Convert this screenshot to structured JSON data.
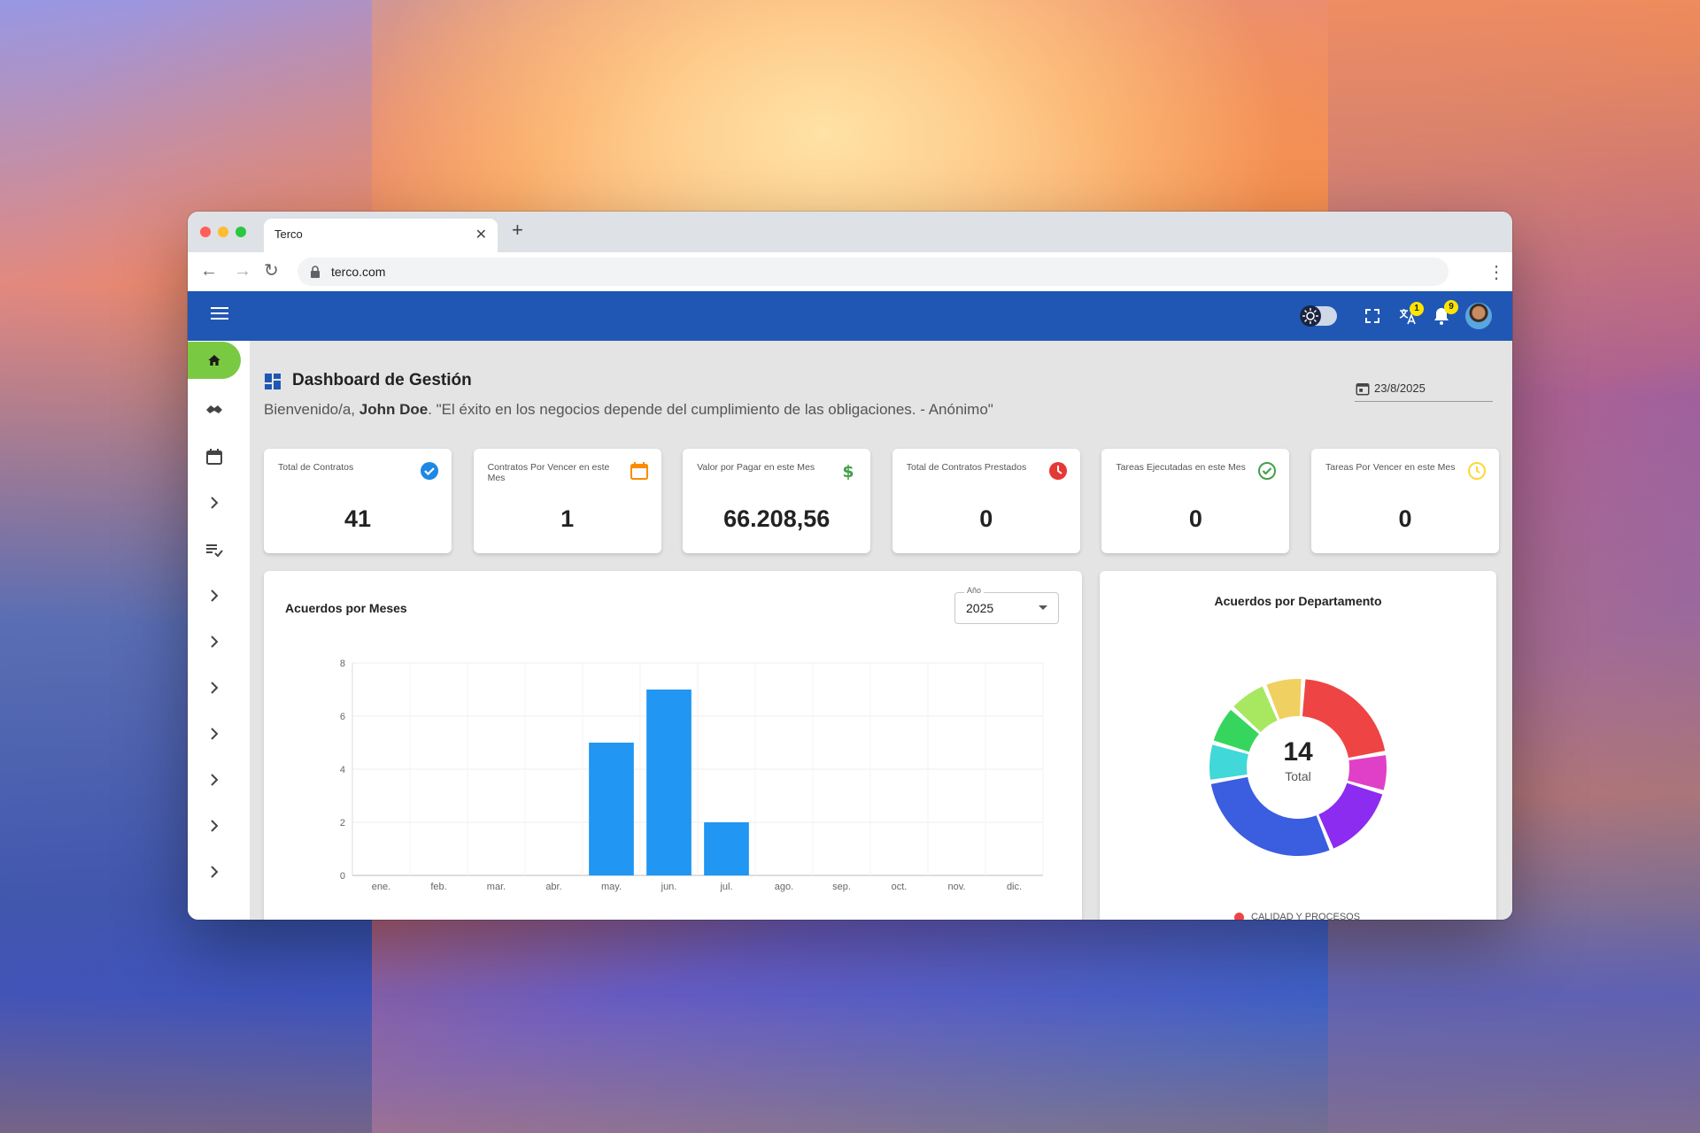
{
  "browser": {
    "tab_title": "Terco",
    "url": "terco.com"
  },
  "appbar": {
    "translate_badge": "1",
    "notifications_badge": "9"
  },
  "page": {
    "title": "Dashboard de Gestión",
    "welcome_prefix": "Bienvenido/a, ",
    "user_name": "John Doe",
    "quote": ". \"El éxito en los negocios depende del cumplimiento de las obligaciones. - Anónimo\"",
    "date": "23/8/2025"
  },
  "stats": [
    {
      "label": "Total de Contratos",
      "value": "41",
      "icon": "check-circle-icon",
      "color": "#1e88e5"
    },
    {
      "label": "Contratos Por Vencer en este Mes",
      "value": "1",
      "icon": "calendar-icon",
      "color": "#fb8c00"
    },
    {
      "label": "Valor por Pagar en este Mes",
      "value": "66.208,56",
      "icon": "dollar-icon",
      "color": "#43a047"
    },
    {
      "label": "Total de Contratos Prestados",
      "value": "0",
      "icon": "clock-icon",
      "color": "#e53935"
    },
    {
      "label": "Tareas Ejecutadas en este Mes",
      "value": "0",
      "icon": "check-outline-icon",
      "color": "#43a047"
    },
    {
      "label": "Tareas Por Vencer en este Mes",
      "value": "0",
      "icon": "clock-outline-icon",
      "color": "#fdd835"
    }
  ],
  "bar_chart": {
    "title": "Acuerdos por Meses",
    "year_label": "Año",
    "year_value": "2025"
  },
  "donut_chart": {
    "title": "Acuerdos por Departamento",
    "total": "14",
    "total_label": "Total",
    "legend_first": "CALIDAD Y PROCESOS",
    "legend_first_color": "#ef4444"
  },
  "chart_data": [
    {
      "type": "bar",
      "title": "Acuerdos por Meses",
      "categories": [
        "ene.",
        "feb.",
        "mar.",
        "abr.",
        "may.",
        "jun.",
        "jul.",
        "ago.",
        "sep.",
        "oct.",
        "nov.",
        "dic."
      ],
      "values": [
        0,
        0,
        0,
        0,
        5,
        7,
        2,
        0,
        0,
        0,
        0,
        0
      ],
      "yticks": [
        0,
        2,
        4,
        6,
        8
      ],
      "ylim": [
        0,
        8
      ],
      "color": "#2196f3",
      "grid": true
    },
    {
      "type": "pie",
      "title": "Acuerdos por Departamento",
      "total": 14,
      "slice_colors": [
        "#ef4444",
        "#e040c8",
        "#8b2cf0",
        "#3b5de0",
        "#40d8d8",
        "#36d65e",
        "#a8e860",
        "#f0d060"
      ],
      "slice_values": [
        3,
        1,
        2,
        4,
        1,
        1,
        1,
        1
      ],
      "legend": [
        "CALIDAD Y PROCESOS"
      ]
    }
  ]
}
